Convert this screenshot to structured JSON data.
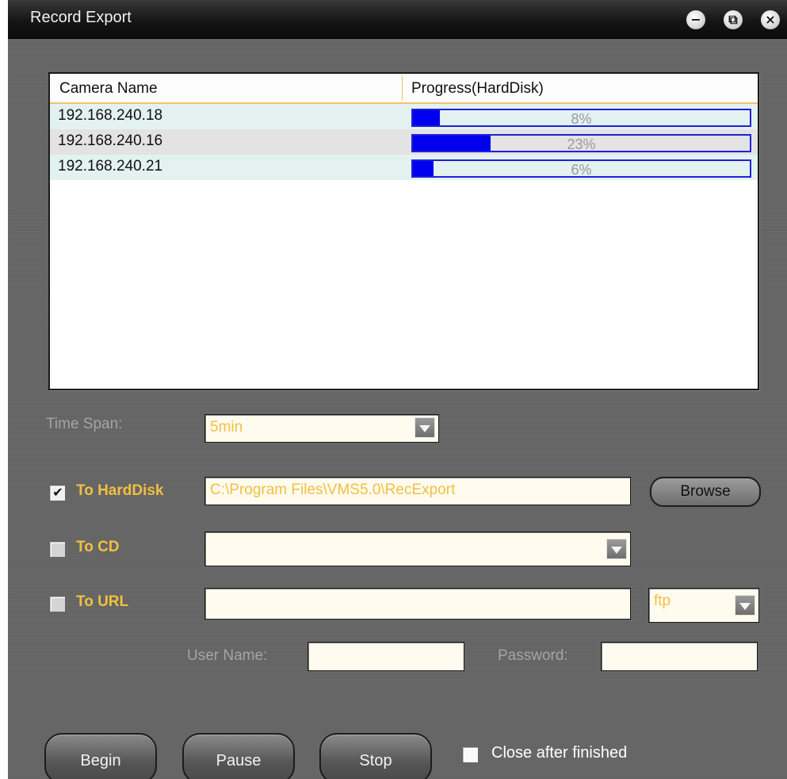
{
  "window": {
    "title": "Record Export",
    "controls": {
      "minimize": "−",
      "restore": "⧉",
      "close": "×"
    }
  },
  "list": {
    "columns": [
      "Camera Name",
      "Progress(HardDisk)"
    ],
    "rows": [
      {
        "camera": "192.168.240.18",
        "progress_pct": 8,
        "progress_text": "8%"
      },
      {
        "camera": "192.168.240.16",
        "progress_pct": 23,
        "progress_text": "23%"
      },
      {
        "camera": "192.168.240.21",
        "progress_pct": 6,
        "progress_text": "6%"
      }
    ]
  },
  "time_span": {
    "label": "Time Span:",
    "value": "5min"
  },
  "to_harddisk": {
    "label": "To HardDisk",
    "checked": true,
    "path": "C:\\Program Files\\VMS5.0\\RecExport",
    "browse_label": "Browse"
  },
  "to_cd": {
    "label": "To CD",
    "checked": false,
    "value": ""
  },
  "to_url": {
    "label": "To URL",
    "checked": false,
    "value": "",
    "protocol": "ftp"
  },
  "credentials": {
    "user_label": "User Name:",
    "user_value": "",
    "password_label": "Password:",
    "password_value": ""
  },
  "actions": {
    "begin": "Begin",
    "pause": "Pause",
    "stop": "Stop",
    "close_after_label": "Close after finished",
    "close_after_checked": false
  },
  "colors": {
    "accent_gold": "#f1c041",
    "progress_blue": "#0000ee",
    "row_tint": "#e3f2f1"
  }
}
